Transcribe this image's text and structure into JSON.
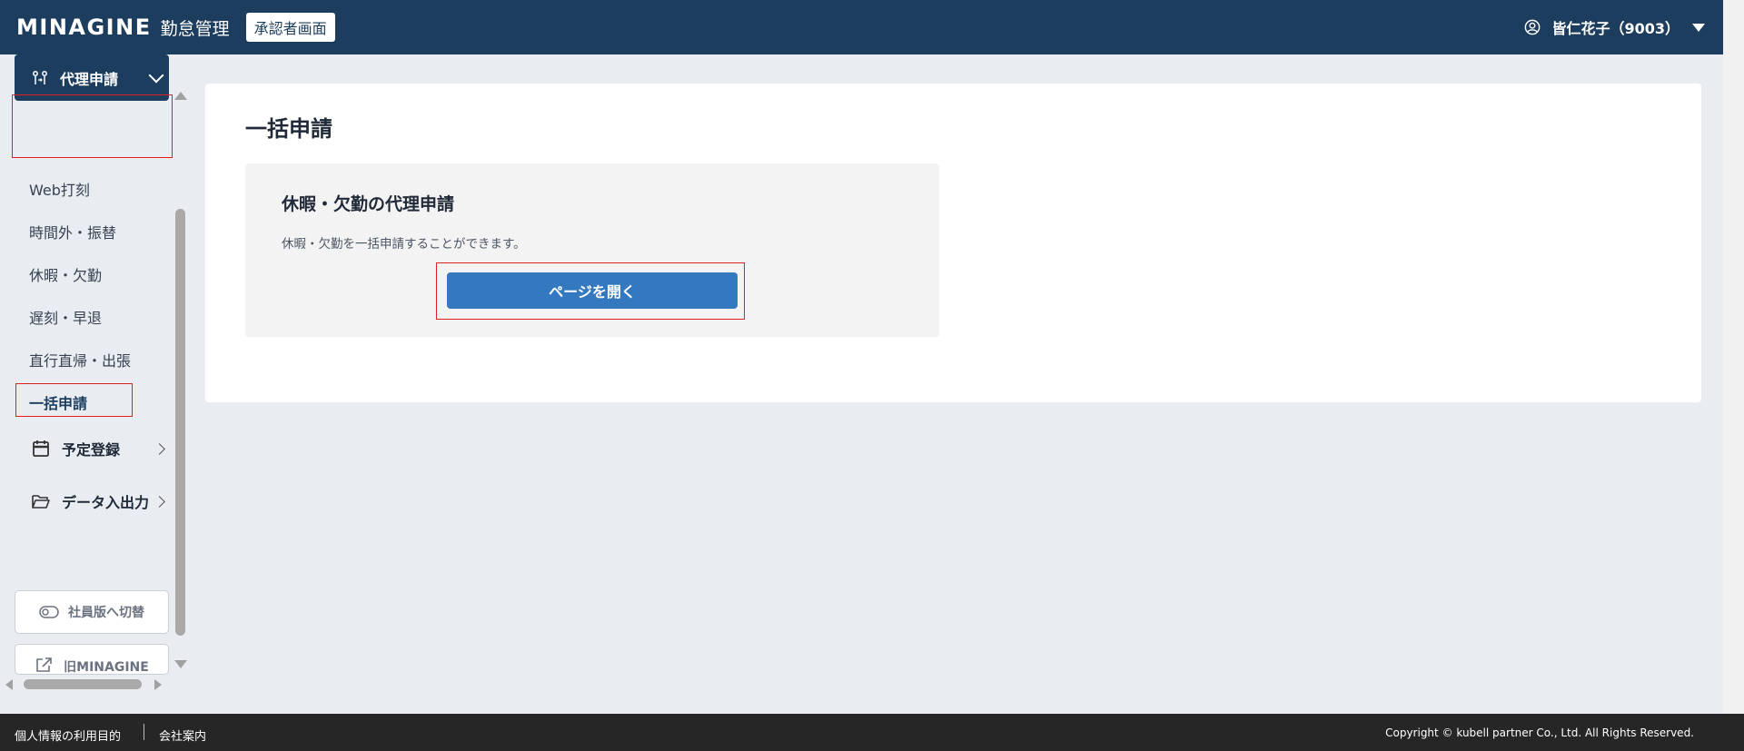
{
  "header": {
    "brand": "MINAGINE",
    "product": "勤怠管理",
    "role_badge": "承認者画面",
    "user_name": "皆仁花子（9003）"
  },
  "sidebar": {
    "group_label": "代理申請",
    "sub_items": [
      {
        "label": "Web打刻"
      },
      {
        "label": "時間外・振替"
      },
      {
        "label": "休暇・欠勤"
      },
      {
        "label": "遅刻・早退"
      },
      {
        "label": "直行直帰・出張"
      },
      {
        "label": "一括申請"
      }
    ],
    "nav": [
      {
        "label": "予定登録"
      },
      {
        "label": "データ入出力"
      }
    ],
    "switch_button": "社員版へ切替",
    "old_button": "旧MINAGINE"
  },
  "main": {
    "title": "一括申請",
    "card": {
      "title": "休暇・欠勤の代理申請",
      "description": "休暇・欠勤を一括申請することができます。",
      "button": "ページを開く"
    }
  },
  "footer": {
    "privacy": "個人情報の利用目的",
    "company": "会社案内",
    "copyright": "Copyright © kubell partner Co., Ltd. All Rights Reserved."
  },
  "colors": {
    "header_bg": "#1c3d5e",
    "accent_button": "#3478c0",
    "highlight_border": "#e02020",
    "footer_bg": "#262626"
  }
}
